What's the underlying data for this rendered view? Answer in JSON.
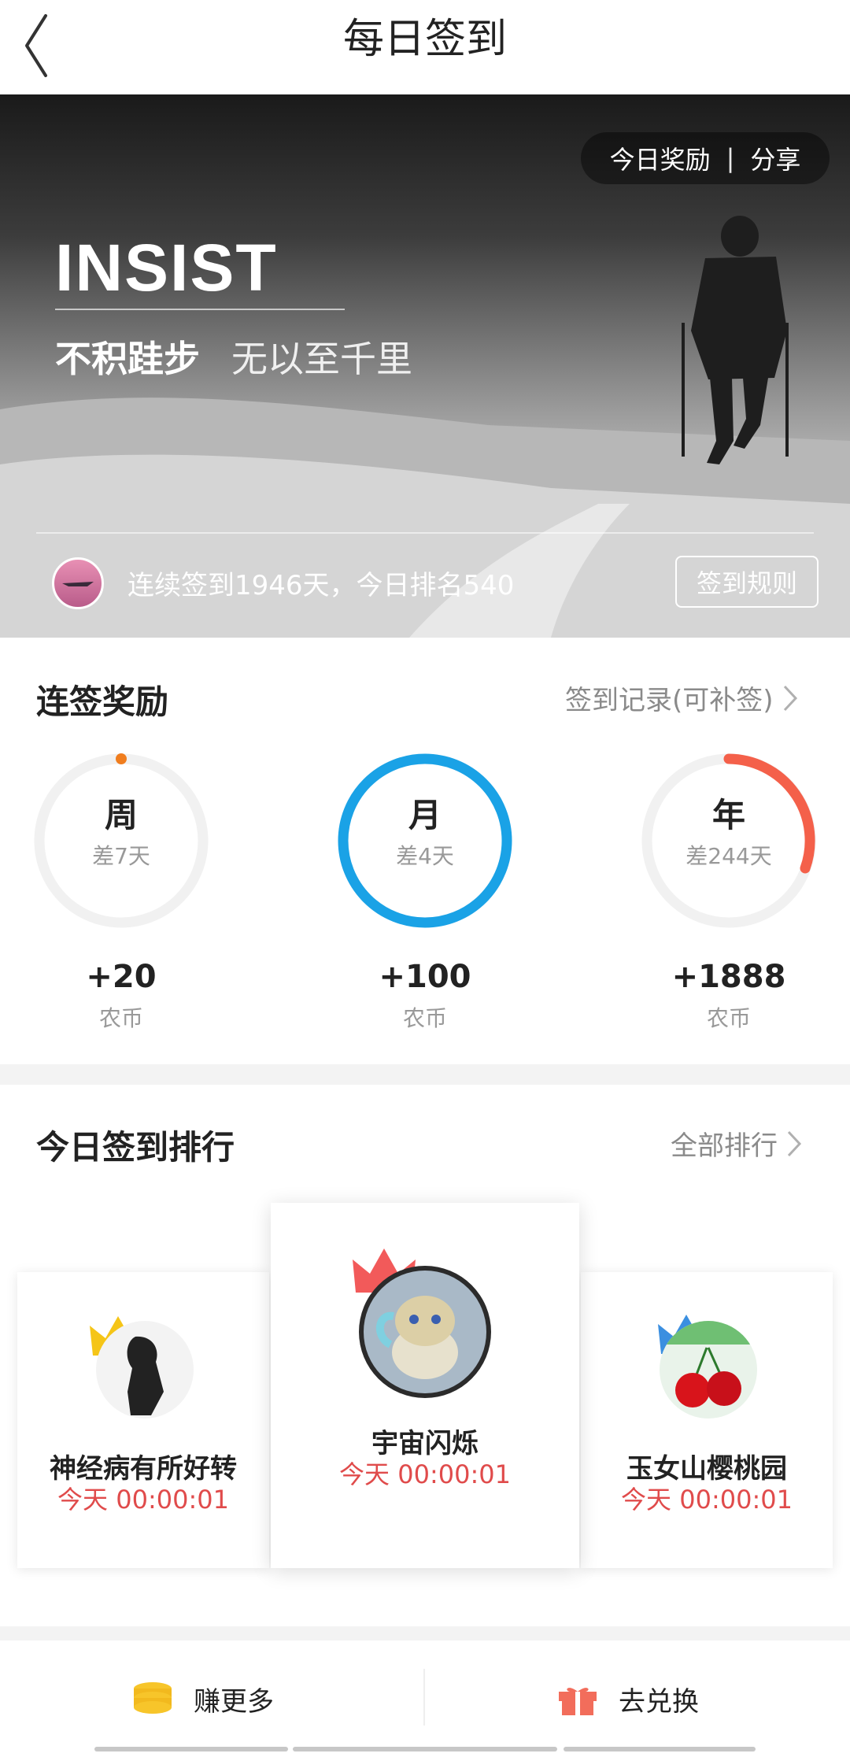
{
  "nav": {
    "title": "每日签到"
  },
  "hero": {
    "reward_label": "今日奖励",
    "separator": "|",
    "share_label": "分享",
    "headline": "INSIST",
    "slogan_main": "不积跬步",
    "slogan_sub": "无以至千里",
    "streak_text": "连续签到1946天，今日排名540",
    "rules_button": "签到规则"
  },
  "streak": {
    "title": "连签奖励",
    "record_link": "签到记录(可补签)",
    "items": [
      {
        "label": "周",
        "remaining": "差7天",
        "reward": "+20",
        "unit": "农币",
        "progress": 0.0,
        "color": "#f07d1e"
      },
      {
        "label": "月",
        "remaining": "差4天",
        "reward": "+100",
        "unit": "农币",
        "progress": 1.0,
        "color": "#1aa2e6"
      },
      {
        "label": "年",
        "remaining": "差244天",
        "reward": "+1888",
        "unit": "农币",
        "progress": 0.33,
        "color": "#f4604a"
      }
    ]
  },
  "ranking": {
    "title": "今日签到排行",
    "all_link": "全部排行",
    "first": {
      "name": "宇宙闪烁",
      "time": "今天 00:00:01"
    },
    "second": {
      "name": "神经病有所好转",
      "time": "今天 00:00:01"
    },
    "third": {
      "name": "玉女山樱桃园",
      "time": "今天 00:00:01"
    }
  },
  "bottom": {
    "earn": "赚更多",
    "redeem": "去兑换"
  },
  "colors": {
    "accent_orange": "#f07d1e",
    "accent_blue": "#1aa2e6",
    "accent_red": "#f4604a",
    "time_red": "#e04b4b"
  }
}
